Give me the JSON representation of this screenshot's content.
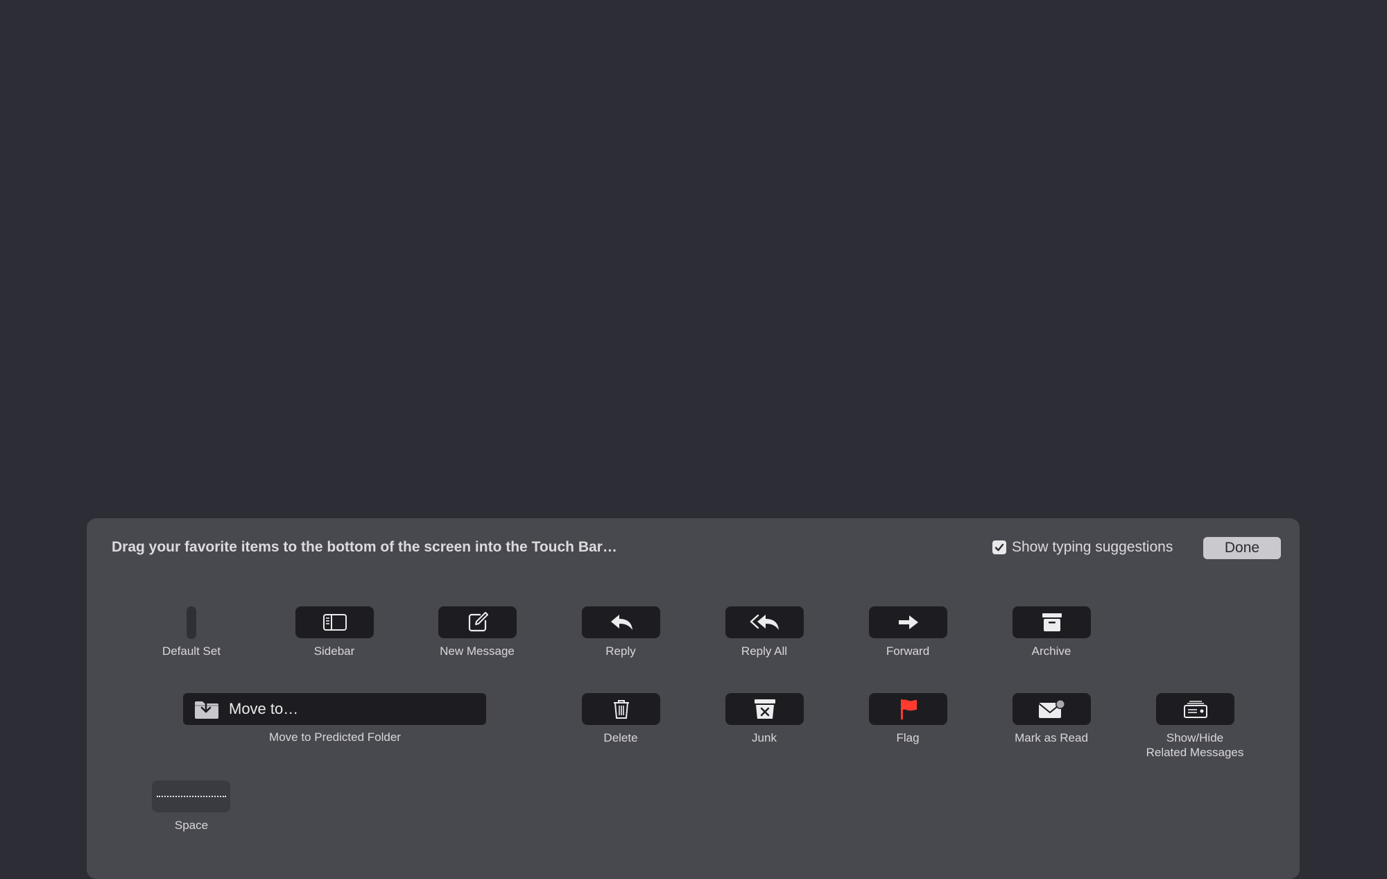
{
  "instructions": "Drag your favorite items to the bottom of the screen into the Touch Bar…",
  "suggestions": {
    "label": "Show typing suggestions",
    "checked": true
  },
  "done_label": "Done",
  "items": {
    "default_set": "Default Set",
    "sidebar": "Sidebar",
    "new_message": "New Message",
    "reply": "Reply",
    "reply_all": "Reply All",
    "forward": "Forward",
    "archive": "Archive",
    "move_to_button": "Move to…",
    "move_to_label": "Move to Predicted Folder",
    "delete": "Delete",
    "junk": "Junk",
    "flag": "Flag",
    "mark_as_read": "Mark as Read",
    "show_hide_line1": "Show/Hide",
    "show_hide_line2": "Related Messages",
    "space": "Space"
  },
  "colors": {
    "flag_red": "#ff3b30",
    "accent_panel": "#48484f",
    "background": "#2d2d35"
  }
}
